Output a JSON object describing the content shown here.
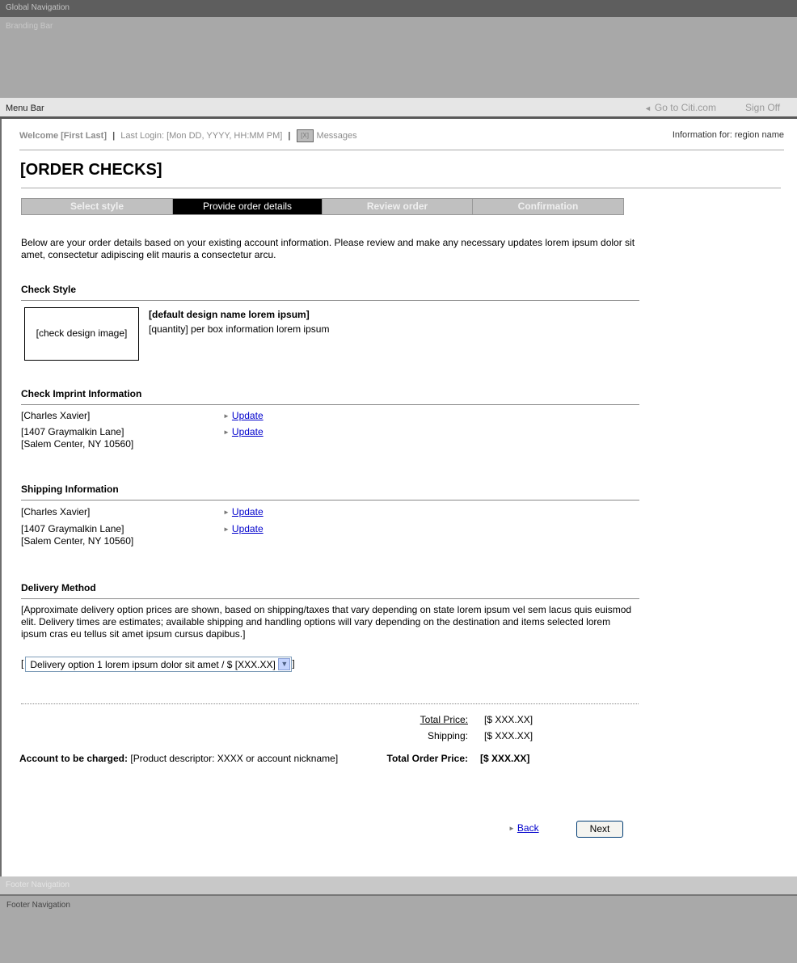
{
  "global_nav": "Global Navigation",
  "branding_bar": "Branding Bar",
  "menu_bar": {
    "label": "Menu Bar",
    "goto_link": "Go to Citi.com",
    "sign_off": "Sign Off"
  },
  "welcome": {
    "name": "Welcome [First Last]",
    "sep": "|",
    "last_login": "Last Login: [Mon DD, YYYY, HH:MM PM]",
    "msg_count": "[X]",
    "messages": "Messages",
    "region": "Information for: region name"
  },
  "page_title": "[ORDER CHECKS]",
  "steps": [
    {
      "label": "Select style",
      "active": false
    },
    {
      "label": "Provide order details",
      "active": true
    },
    {
      "label": "Review order",
      "active": false
    },
    {
      "label": "Confirmation",
      "active": false
    }
  ],
  "intro": "Below are your order details based on your existing account information.  Please review and make any necessary updates lorem ipsum dolor sit amet, consectetur adipiscing elit mauris a consectetur arcu.",
  "check_style": {
    "heading": "Check Style",
    "image_label": "[check design image]",
    "design_name": "[default design name lorem ipsum]",
    "quantity": "[quantity] per box information lorem ipsum"
  },
  "imprint": {
    "heading": "Check Imprint Information",
    "name": "[Charles Xavier]",
    "address1": "[1407 Graymalkin Lane]",
    "address2": "[Salem Center, NY  10560]",
    "update_label": "Update"
  },
  "shipping": {
    "heading": "Shipping Information",
    "name": "[Charles Xavier]",
    "address1": "[1407 Graymalkin Lane]",
    "address2": "[Salem Center, NY  10560]",
    "update_label": "Update"
  },
  "delivery": {
    "heading": "Delivery Method",
    "text": "[Approximate delivery option prices are shown, based on shipping/taxes that vary depending on state lorem ipsum vel sem lacus quis euismod elit.  Delivery times are estimates; available shipping and handling options will vary depending on the destination and items selected lorem ipsum cras eu tellus sit amet ipsum cursus dapibus.]",
    "bracket_open": "[",
    "bracket_close": "]",
    "selected_option": "Delivery option 1 lorem ipsum dolor sit amet / $ [XXX.XX]"
  },
  "pricing": {
    "total_price_label": "Total Price:",
    "total_price_value": "[$  XXX.XX]",
    "shipping_label": "Shipping:",
    "shipping_value": "[$  XXX.XX]",
    "account_label": "Account to be charged:",
    "account_value": "[Product descriptor: XXXX or account nickname]",
    "total_order_label": "Total Order Price:",
    "total_order_value": "[$  XXX.XX]"
  },
  "actions": {
    "back": "Back",
    "next": "Next"
  },
  "footer1": "Footer Navigation",
  "footer2": "Footer Navigation"
}
